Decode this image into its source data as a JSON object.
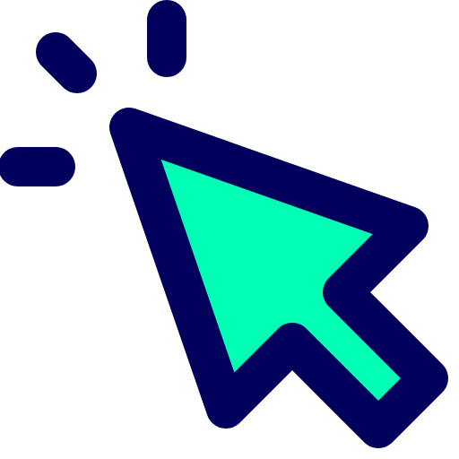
{
  "icon": {
    "name": "cursor-click-icon",
    "colors": {
      "stroke": "#00005C",
      "fill": "#00FFB4",
      "background": "#FFFFFF"
    }
  }
}
